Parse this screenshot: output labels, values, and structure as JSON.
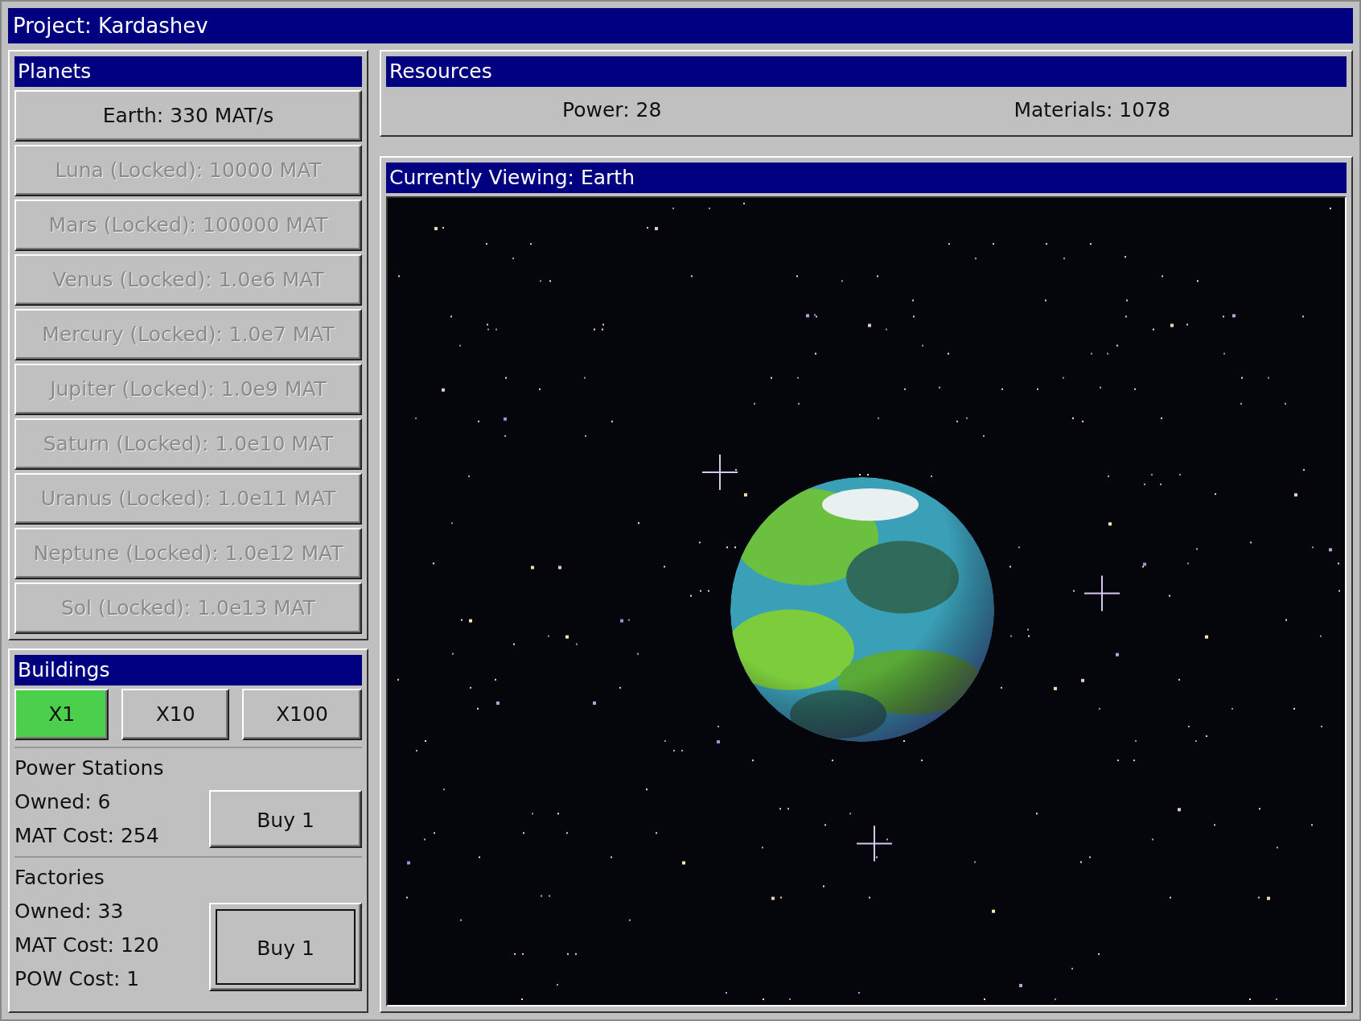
{
  "window": {
    "title": "Project: Kardashev"
  },
  "planets": {
    "title": "Planets",
    "items": [
      {
        "label": "Earth: 330 MAT/s",
        "locked": false
      },
      {
        "label": "Luna (Locked): 10000 MAT",
        "locked": true
      },
      {
        "label": "Mars (Locked): 100000 MAT",
        "locked": true
      },
      {
        "label": "Venus (Locked): 1.0e6 MAT",
        "locked": true
      },
      {
        "label": "Mercury (Locked): 1.0e7 MAT",
        "locked": true
      },
      {
        "label": "Jupiter (Locked): 1.0e9 MAT",
        "locked": true
      },
      {
        "label": "Saturn (Locked): 1.0e10 MAT",
        "locked": true
      },
      {
        "label": "Uranus (Locked): 1.0e11 MAT",
        "locked": true
      },
      {
        "label": "Neptune (Locked): 1.0e12 MAT",
        "locked": true
      },
      {
        "label": "Sol (Locked): 1.0e13 MAT",
        "locked": true
      }
    ]
  },
  "buildings": {
    "title": "Buildings",
    "multipliers": [
      {
        "label": "X1",
        "selected": true
      },
      {
        "label": "X10",
        "selected": false
      },
      {
        "label": "X100",
        "selected": false
      }
    ],
    "items": [
      {
        "name": "Power Stations",
        "lines": [
          "Owned: 6",
          "MAT Cost: 254"
        ],
        "button": "Buy 1",
        "focused": false
      },
      {
        "name": "Factories",
        "lines": [
          "Owned: 33",
          "MAT Cost: 120",
          "POW Cost: 1"
        ],
        "button": "Buy 1",
        "focused": true
      }
    ]
  },
  "resources": {
    "title": "Resources",
    "items": [
      "Power: 28",
      "Materials: 1078"
    ]
  },
  "viewer": {
    "title": "Currently Viewing: Earth"
  }
}
